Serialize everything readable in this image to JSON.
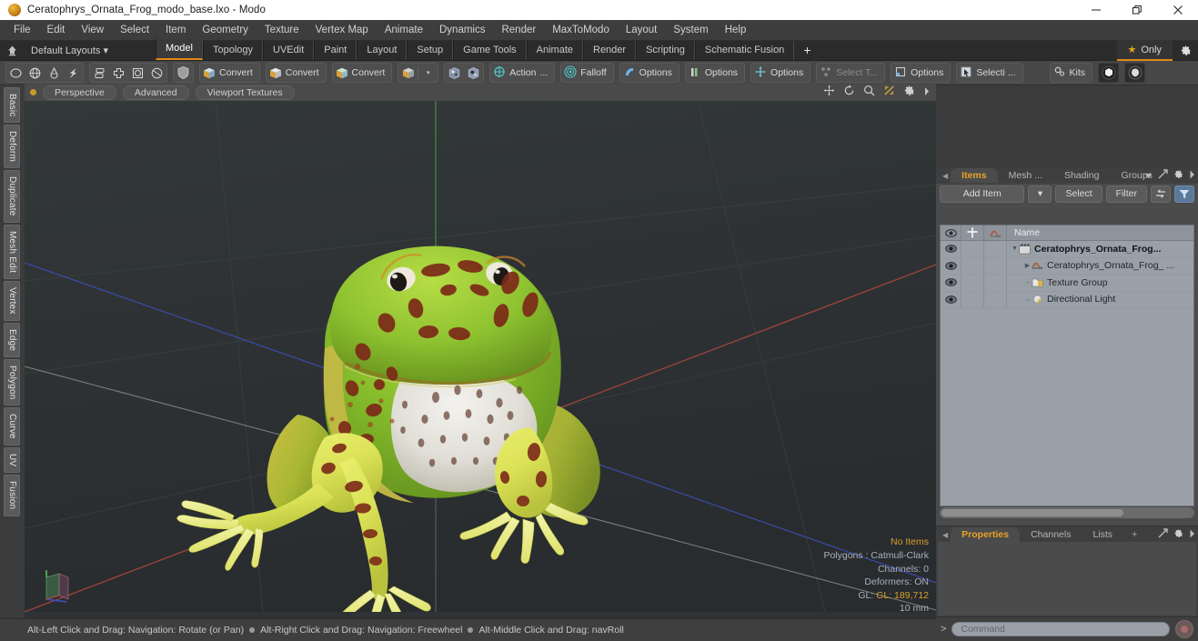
{
  "window": {
    "title": "Ceratophrys_Ornata_Frog_modo_base.lxo - Modo",
    "app_icon": "modo-app-icon",
    "minimize": "—",
    "maximize": "❐",
    "close": "✕"
  },
  "menubar": {
    "items": [
      "File",
      "Edit",
      "View",
      "Select",
      "Item",
      "Geometry",
      "Texture",
      "Vertex Map",
      "Animate",
      "Dynamics",
      "Render",
      "MaxToModo",
      "Layout",
      "System",
      "Help"
    ]
  },
  "layoutbar": {
    "home_icon": "home-icon",
    "default_layouts": "Default Layouts ▾",
    "tabs": [
      {
        "label": "Model",
        "active": true
      },
      {
        "label": "Topology",
        "active": false
      },
      {
        "label": "UVEdit",
        "active": false
      },
      {
        "label": "Paint",
        "active": false
      },
      {
        "label": "Layout",
        "active": false
      },
      {
        "label": "Setup",
        "active": false
      },
      {
        "label": "Game Tools",
        "active": false
      },
      {
        "label": "Animate",
        "active": false
      },
      {
        "label": "Render",
        "active": false
      },
      {
        "label": "Scripting",
        "active": false
      },
      {
        "label": "Schematic Fusion",
        "active": false
      }
    ],
    "add_tab": "+",
    "only_label": "Only",
    "only_star": "★",
    "gear_icon": "gear-icon"
  },
  "toolbar": {
    "primitive_icons": [
      "circle-icon",
      "globe-icon",
      "teardrop-icon",
      "lightning-icon"
    ],
    "mesh_icons": [
      "stack-icon",
      "cross-icon",
      "square-o-icon",
      "circle-o-icon"
    ],
    "shield_icon": "shield-icon",
    "convert_buttons": [
      {
        "label": "Convert",
        "icon": "cube-blue-icon"
      },
      {
        "label": "Convert",
        "icon": "cube-yellow-icon"
      },
      {
        "label": "Convert",
        "icon": "cube-green-icon"
      }
    ],
    "cube_dropdown_icon": "cube-icon",
    "dropdown_caret": "▾",
    "uv_icons": [
      "uv-sphere-icon",
      "uv-sphere-dark-icon"
    ],
    "action_center": {
      "label": "Action",
      "suffix": "...",
      "icon": "crosshair-icon"
    },
    "falloff": {
      "label": "Falloff",
      "icon": "falloff-icon"
    },
    "options_groups": [
      {
        "label": "Options",
        "icon": "snap-icon",
        "dim": false
      },
      {
        "label": "Options",
        "icon": "bars-icon",
        "dim": false
      },
      {
        "label": "Options",
        "icon": "move-icon",
        "dim": false
      },
      {
        "label": "Select T...",
        "icon": "select-through-icon",
        "dim": true
      },
      {
        "label": "Options",
        "icon": "layer-icon",
        "dim": false
      },
      {
        "label": "Selecti ...",
        "icon": "cursor-icon",
        "dim": false
      }
    ],
    "kits": {
      "label": "Kits",
      "icon": "kits-icon"
    },
    "right_icons": [
      "sphere-white-icon",
      "unreal-icon"
    ]
  },
  "left_rail": {
    "tabs": [
      "Basic",
      "Deform",
      "Duplicate",
      "Mesh Edit",
      "Vertex",
      "Edge",
      "Polygon",
      "Curve",
      "UV",
      "Fusion"
    ]
  },
  "viewport": {
    "dot_icon": "viewport-state-dot",
    "chips": [
      "Perspective",
      "Advanced",
      "Viewport Textures"
    ],
    "header_icons": [
      "pan-icon",
      "rotate-icon",
      "zoom-icon",
      "fit-icon",
      "gear-icon",
      "chevron-right-icon"
    ],
    "axis_gizmo": "axis-gizmo",
    "stats": {
      "selection": "No Items",
      "polygons": "Polygons : Catmull-Clark",
      "channels": "Channels: 0",
      "deformers": "Deformers: ON",
      "gl": "GL: 189,712",
      "scale": "10 mm"
    }
  },
  "statusbar": {
    "hint1": "Alt-Left Click and Drag: Navigation: Rotate (or Pan)",
    "hint2": "Alt-Right Click and Drag: Navigation: Freewheel",
    "hint3": "Alt-Middle Click and Drag: navRoll"
  },
  "right_panel": {
    "tabs": [
      {
        "label": "Items",
        "active": true
      },
      {
        "label": "Mesh ...",
        "active": false
      },
      {
        "label": "Shading",
        "active": false
      },
      {
        "label": "Groups",
        "active": false
      }
    ],
    "tab_right_icons": [
      "chevron-down-icon",
      "expand-icon",
      "gear-icon",
      "chevron-right-icon"
    ],
    "toolrow": {
      "add_item": "Add Item",
      "add_item_caret": "▾",
      "select": "Select",
      "filter": "Filter",
      "swap_icon": "swap-icon",
      "funnel_icon": "funnel-icon"
    },
    "item_list": {
      "columns": [
        "eye-icon",
        "locator-icon",
        "shading-icon",
        "Name"
      ],
      "rows": [
        {
          "label": "Ceratophrys_Ornata_Frog...",
          "icon": "group-icon",
          "indent": 0,
          "tree": "▼",
          "bold": true
        },
        {
          "label": "Ceratophrys_Ornata_Frog_ ...",
          "icon": "mesh-icon",
          "indent": 1,
          "tree": "▶",
          "bold": false
        },
        {
          "label": "Texture Group",
          "icon": "texture-group-icon",
          "indent": 1,
          "tree": "→",
          "bold": false
        },
        {
          "label": "Directional Light",
          "icon": "light-icon",
          "indent": 1,
          "tree": "→",
          "bold": false
        }
      ]
    },
    "properties": {
      "tabs": [
        {
          "label": "Properties",
          "active": true
        },
        {
          "label": "Channels",
          "active": false
        },
        {
          "label": "Lists",
          "active": false
        }
      ],
      "add_tab": "+",
      "right_icons": [
        "expand-icon",
        "gear-icon",
        "chevron-right-icon"
      ]
    },
    "command": {
      "prompt": ">",
      "placeholder": "Command",
      "record_icon": "record-icon"
    }
  },
  "colors": {
    "accent_orange": "#e08a16",
    "tab_active_text": "#e9a227",
    "viewport_bg": "#2f3335",
    "axis_red": "#b0483f",
    "axis_green": "#3f9a3f",
    "axis_blue": "#3c4fb4",
    "stats_text": "#a6b0bb"
  }
}
